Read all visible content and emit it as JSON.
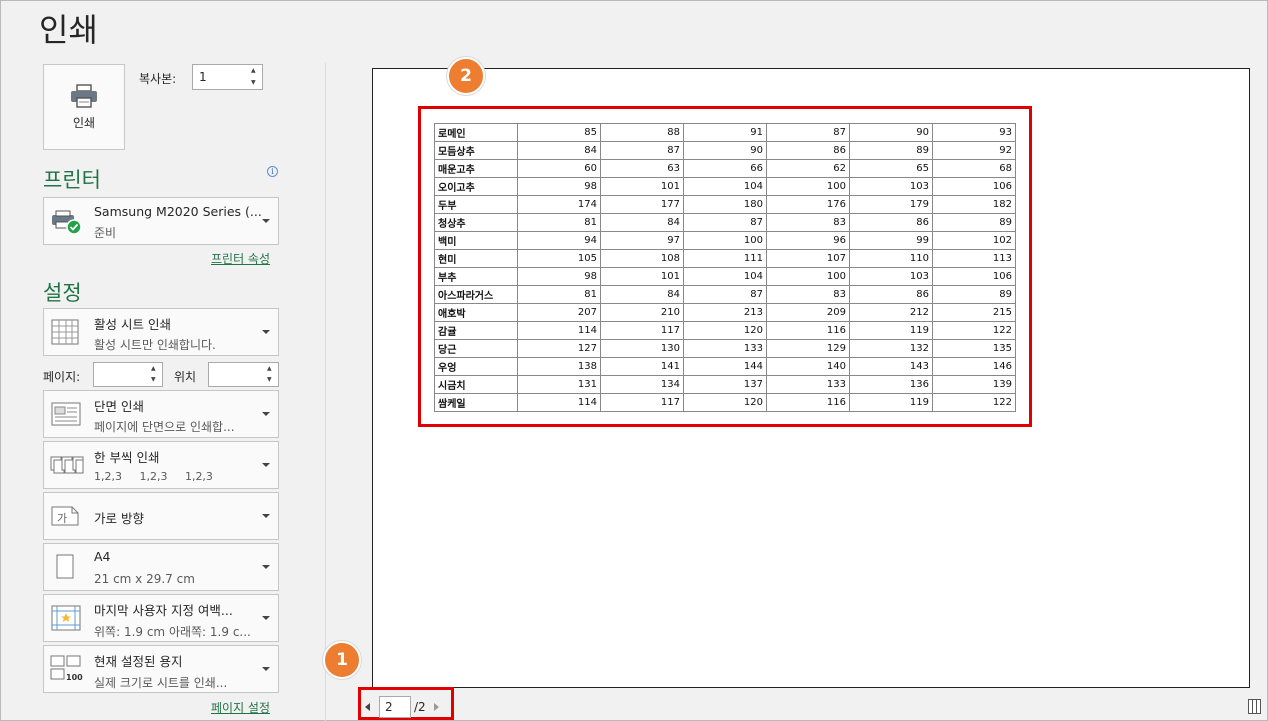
{
  "title": "인쇄",
  "print_button": {
    "label": "인쇄",
    "icon": "printer-icon"
  },
  "copies": {
    "label": "복사본:",
    "value": "1"
  },
  "printer_section": {
    "heading": "프린터",
    "name": "Samsung M2020 Series (...",
    "status": "준비",
    "properties_link": "프린터 속성"
  },
  "settings_section": {
    "heading": "설정",
    "items": [
      {
        "main": "활성 시트 인쇄",
        "sub": "활성 시트만 인쇄합니다.",
        "icon": "sheet-grid-icon"
      },
      {
        "main": "단면 인쇄",
        "sub": "페이지에 단면으로 인쇄합...",
        "icon": "one-sided-icon"
      },
      {
        "main": "한 부씩 인쇄",
        "sub": "1,2,3     1,2,3     1,2,3",
        "icon": "collated-icon"
      },
      {
        "main": "가로 방향",
        "sub": "",
        "icon": "landscape-icon"
      },
      {
        "main": "A4",
        "sub": "21 cm x 29.7 cm",
        "icon": "paper-size-icon"
      },
      {
        "main": "마지막 사용자 지정 여백...",
        "sub": "위쪽: 1.9 cm 아래쪽: 1.9 c...",
        "icon": "margins-icon"
      },
      {
        "main": "현재 설정된 용지",
        "sub": "실제 크기로 시트를 인쇄...",
        "icon": "scaling-icon"
      }
    ],
    "pages_label": "페이지:",
    "to_label": "위치",
    "page_setup_link": "페이지 설정"
  },
  "markers": {
    "m1": "1",
    "m2": "2"
  },
  "pager": {
    "current": "2",
    "total": "/2"
  },
  "table": [
    [
      "로메인",
      "85",
      "88",
      "91",
      "87",
      "90",
      "93"
    ],
    [
      "모듬상추",
      "84",
      "87",
      "90",
      "86",
      "89",
      "92"
    ],
    [
      "매운고추",
      "60",
      "63",
      "66",
      "62",
      "65",
      "68"
    ],
    [
      "오이고추",
      "98",
      "101",
      "104",
      "100",
      "103",
      "106"
    ],
    [
      "두부",
      "174",
      "177",
      "180",
      "176",
      "179",
      "182"
    ],
    [
      "청상추",
      "81",
      "84",
      "87",
      "83",
      "86",
      "89"
    ],
    [
      "백미",
      "94",
      "97",
      "100",
      "96",
      "99",
      "102"
    ],
    [
      "현미",
      "105",
      "108",
      "111",
      "107",
      "110",
      "113"
    ],
    [
      "부추",
      "98",
      "101",
      "104",
      "100",
      "103",
      "106"
    ],
    [
      "아스파라거스",
      "81",
      "84",
      "87",
      "83",
      "86",
      "89"
    ],
    [
      "애호박",
      "207",
      "210",
      "213",
      "209",
      "212",
      "215"
    ],
    [
      "감귤",
      "114",
      "117",
      "120",
      "116",
      "119",
      "122"
    ],
    [
      "당근",
      "127",
      "130",
      "133",
      "129",
      "132",
      "135"
    ],
    [
      "우엉",
      "138",
      "141",
      "144",
      "140",
      "143",
      "146"
    ],
    [
      "시금치",
      "131",
      "134",
      "137",
      "133",
      "136",
      "139"
    ],
    [
      "쌈케일",
      "114",
      "117",
      "120",
      "116",
      "119",
      "122"
    ]
  ],
  "colors": {
    "accent": "#217346",
    "marker": "#ed7d31",
    "highlight": "#e00000"
  }
}
